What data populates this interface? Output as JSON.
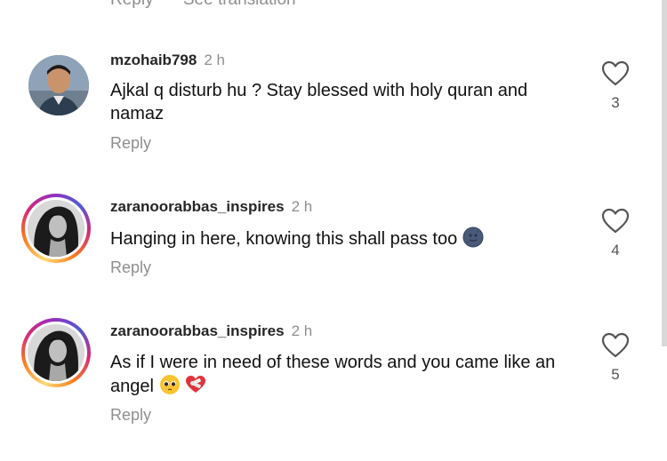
{
  "top_partial": {
    "reply_label": "Reply",
    "translation_label": "See translation"
  },
  "comments": [
    {
      "username": "mzohaib798",
      "time": "2 h",
      "text": "Ajkal q disturb hu ? Stay blessed with holy quran and namaz",
      "reply_label": "Reply",
      "likes": "3",
      "has_story_ring": false
    },
    {
      "username": "zaranoorabbas_inspires",
      "time": "2 h",
      "text": "Hanging in here, knowing this shall pass too",
      "emoji": [
        "new-moon-face"
      ],
      "reply_label": "Reply",
      "likes": "4",
      "has_story_ring": true
    },
    {
      "username": "zaranoorabbas_inspires",
      "time": "2 h",
      "text": "As if I were in need of these words and you came like an angel",
      "emoji": [
        "pleading-face",
        "mending-heart"
      ],
      "reply_label": "Reply",
      "likes": "5",
      "has_story_ring": true
    }
  ],
  "colors": {
    "text": "#111111",
    "secondary": "#8e8e8e",
    "story_ring": "#d62976"
  }
}
